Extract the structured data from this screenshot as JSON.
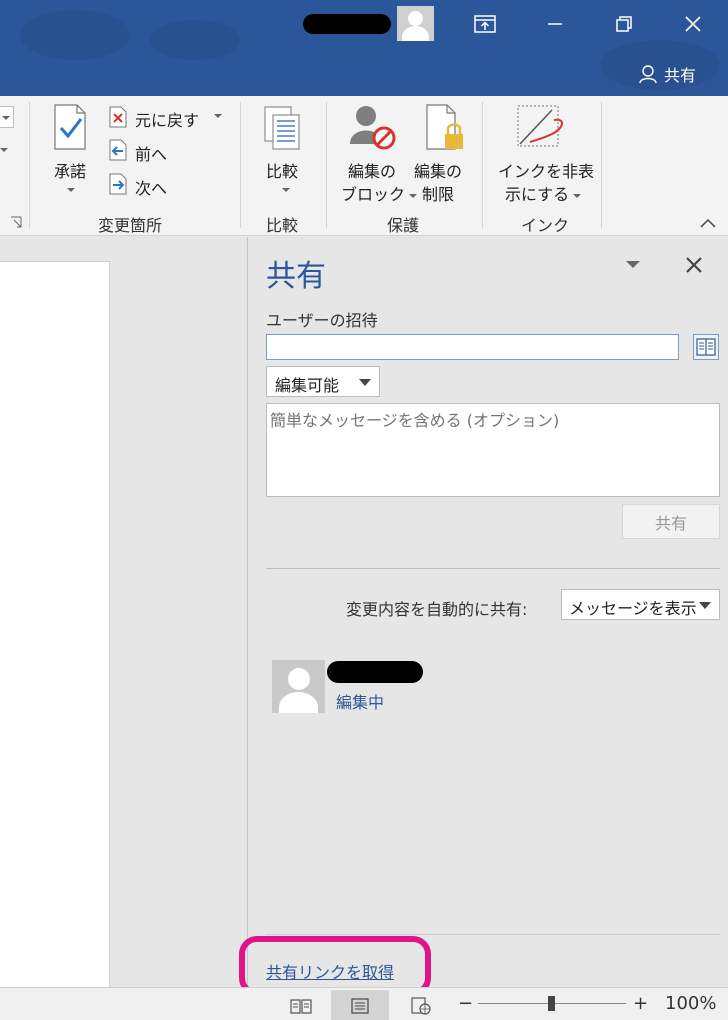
{
  "titlebar": {
    "share_label": "共有",
    "accent": "#2b579a"
  },
  "ribbon": {
    "accept_label": "承諾",
    "undo_label": "元に戻す",
    "prev_label": "前へ",
    "next_label": "次へ",
    "group_changes": "変更箇所",
    "compare_label": "比較",
    "group_compare": "比較",
    "block_label_1": "編集の",
    "block_label_2": "ブロック",
    "restrict_label_1": "編集の",
    "restrict_label_2": "制限",
    "group_protect": "保護",
    "ink_label_1": "インクを非表",
    "ink_label_2": "示にする",
    "group_ink": "インク"
  },
  "pane": {
    "title": "共有",
    "invite_label": "ユーザーの招待",
    "invite_value": "",
    "permission": "編集可能",
    "message_placeholder": "簡単なメッセージを含める (オプション)",
    "share_button": "共有",
    "auto_share_label": "変更内容を自動的に共有:",
    "auto_share_value": "メッセージを表示",
    "user_status": "編集中",
    "get_link": "共有リンクを取得"
  },
  "statusbar": {
    "zoom_minus": "−",
    "zoom_plus": "+",
    "zoom_level": "100%"
  },
  "colors": {
    "highlight": "#e0148a",
    "link": "#2b579a"
  }
}
